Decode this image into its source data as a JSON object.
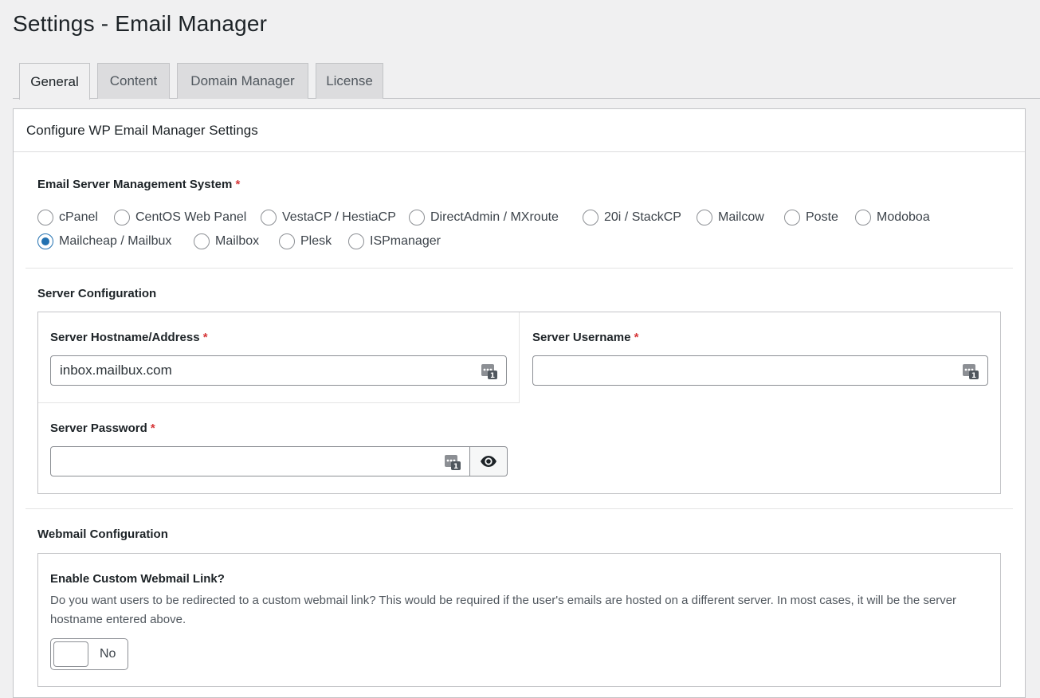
{
  "page": {
    "title": "Settings - Email Manager"
  },
  "tabs": [
    {
      "label": "General",
      "active": true
    },
    {
      "label": "Content",
      "active": false
    },
    {
      "label": "Domain Manager",
      "active": false
    },
    {
      "label": "License",
      "active": false
    }
  ],
  "card": {
    "title": "Configure WP Email Manager Settings"
  },
  "server_system": {
    "label": "Email Server Management System",
    "required_mark": "*",
    "options": [
      {
        "label": "cPanel",
        "checked": false
      },
      {
        "label": "CentOS Web Panel",
        "checked": false
      },
      {
        "label": "VestaCP / HestiaCP",
        "checked": false
      },
      {
        "label": "DirectAdmin / MXroute",
        "checked": false
      },
      {
        "label": "20i / StackCP",
        "checked": false
      },
      {
        "label": "Mailcow",
        "checked": false
      },
      {
        "label": "Poste",
        "checked": false
      },
      {
        "label": "Modoboa",
        "checked": false
      },
      {
        "label": "Mailcheap / Mailbux",
        "checked": true
      },
      {
        "label": "Mailbox",
        "checked": false
      },
      {
        "label": "Plesk",
        "checked": false
      },
      {
        "label": "ISPmanager",
        "checked": false
      }
    ]
  },
  "server_config": {
    "heading": "Server Configuration",
    "hostname": {
      "label": "Server Hostname/Address",
      "required_mark": "*",
      "value": "inbox.mailbux.com"
    },
    "username": {
      "label": "Server Username",
      "required_mark": "*",
      "value": ""
    },
    "password": {
      "label": "Server Password",
      "required_mark": "*",
      "value": ""
    }
  },
  "webmail_config": {
    "heading": "Webmail Configuration",
    "custom_link": {
      "label": "Enable Custom Webmail Link?",
      "description": "Do you want users to be redirected to a custom webmail link? This would be required if the user's emails are hosted on a different server. In most cases, it will be the server hostname entered above.",
      "toggle_label": "No",
      "enabled": false
    }
  },
  "icons": {
    "password_manager": "keypass-icon",
    "show_password": "eye-icon"
  },
  "colors": {
    "accent": "#2271b1",
    "required": "#d63638"
  }
}
